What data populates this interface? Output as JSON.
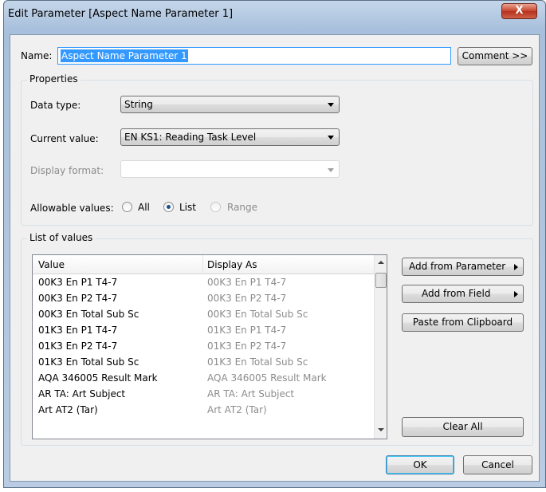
{
  "window": {
    "title": "Edit Parameter [Aspect Name Parameter 1]",
    "close_glyph": "X"
  },
  "name_row": {
    "label": "Name:",
    "value": "Aspect Name Parameter 1",
    "comment_button": "Comment >>"
  },
  "properties": {
    "group_title": "Properties",
    "data_type_label": "Data type:",
    "data_type_value": "String",
    "current_value_label": "Current value:",
    "current_value_value": "EN KS1: Reading Task Level",
    "display_format_label": "Display format:",
    "display_format_value": "",
    "allowable_label": "Allowable values:",
    "options": [
      {
        "label": "All",
        "selected": false,
        "enabled": true
      },
      {
        "label": "List",
        "selected": true,
        "enabled": true
      },
      {
        "label": "Range",
        "selected": false,
        "enabled": false
      }
    ]
  },
  "list_of_values": {
    "group_title": "List of values",
    "columns": [
      "Value",
      "Display As"
    ],
    "rows": [
      [
        "00K3 En P1 T4-7",
        "00K3 En P1 T4-7"
      ],
      [
        "00K3 En P2 T4-7",
        "00K3 En P2 T4-7"
      ],
      [
        "00K3 En Total Sub Sc",
        "00K3 En Total Sub Sc"
      ],
      [
        "01K3 En P1 T4-7",
        "01K3 En P1 T4-7"
      ],
      [
        "01K3 En P2 T4-7",
        "01K3 En P2 T4-7"
      ],
      [
        "01K3 En Total Sub Sc",
        "01K3 En Total Sub Sc"
      ],
      [
        "AQA 346005 Result Mark",
        "AQA 346005 Result Mark"
      ],
      [
        "AR TA: Art Subject",
        "AR TA: Art Subject"
      ],
      [
        "Art AT2 (Tar)",
        "Art AT2 (Tar)"
      ]
    ],
    "buttons": {
      "add_from_parameter": "Add from Parameter",
      "add_from_field": "Add from Field",
      "paste_from_clipboard": "Paste from Clipboard",
      "clear_all": "Clear All"
    }
  },
  "footer": {
    "ok": "OK",
    "cancel": "Cancel"
  },
  "colors": {
    "accent_focus": "#3399ff",
    "selection": "#3399ff",
    "disabled_text": "#8c8c8c"
  }
}
